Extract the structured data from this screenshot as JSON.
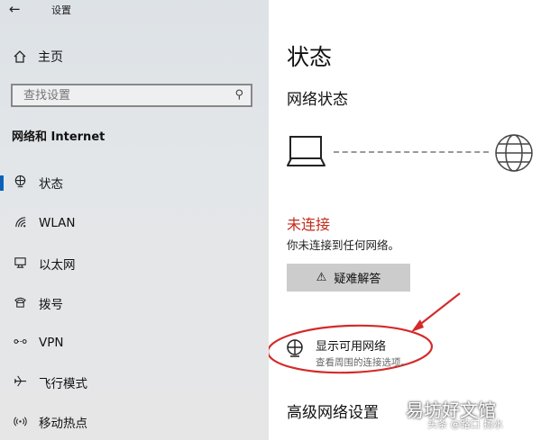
{
  "app": {
    "back_icon": "arrow-left-icon",
    "title": "设置"
  },
  "sidebar": {
    "home_label": "主页",
    "search_placeholder": "查找设置",
    "section_title": "网络和 Internet",
    "items": [
      {
        "label": "状态",
        "icon": "status-globe-icon",
        "active": true
      },
      {
        "label": "WLAN",
        "icon": "wifi-icon"
      },
      {
        "label": "以太网",
        "icon": "ethernet-icon"
      },
      {
        "label": "拨号",
        "icon": "dialup-icon"
      },
      {
        "label": "VPN",
        "icon": "vpn-icon"
      },
      {
        "label": "飞行模式",
        "icon": "airplane-icon"
      },
      {
        "label": "移动热点",
        "icon": "hotspot-icon"
      }
    ]
  },
  "main": {
    "title": "状态",
    "network_status_heading": "网络状态",
    "state": "未连接",
    "state_desc": "你未连接到任何网络。",
    "troubleshoot_label": "疑难解答",
    "available_networks": {
      "label": "显示可用网络",
      "desc": "查看周围的连接选项。"
    },
    "advanced_heading": "高级网络设置"
  },
  "colors": {
    "accent": "#0a62b8",
    "error": "#c42b1c",
    "annotation": "#d42a2a"
  },
  "watermark": {
    "text": "易坊好文馆",
    "sub": "头条 @路口 扬水"
  }
}
